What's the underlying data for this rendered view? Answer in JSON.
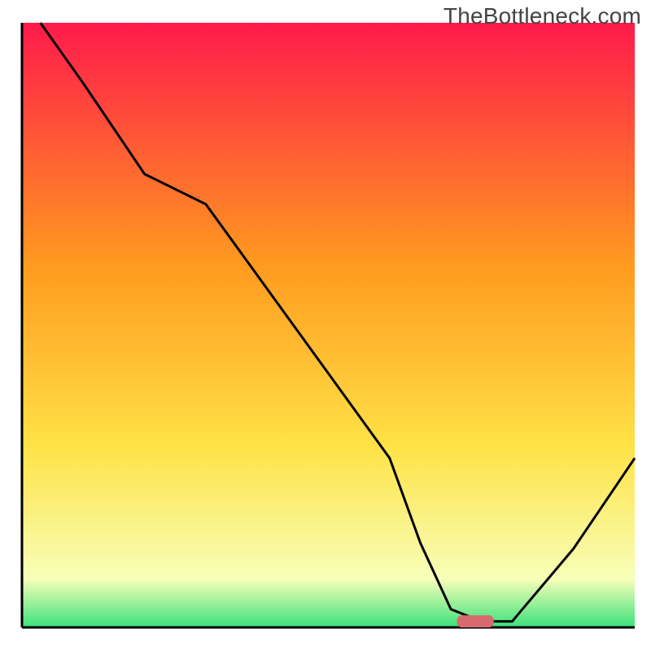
{
  "watermark": "TheBottleneck.com",
  "chart_data": {
    "type": "line",
    "title": "",
    "xlabel": "",
    "ylabel": "",
    "xlim": [
      0,
      100
    ],
    "ylim": [
      0,
      100
    ],
    "grid": false,
    "legend": false,
    "background_gradient": [
      "#ff1a4b",
      "#ff9a1f",
      "#ffe246",
      "#f7ffb8",
      "#3be27c"
    ],
    "series": [
      {
        "name": "bottleneck-curve",
        "x": [
          3,
          10,
          20,
          30,
          40,
          50,
          60,
          65,
          70,
          75,
          80,
          90,
          100
        ],
        "y": [
          100,
          90,
          75,
          70,
          56,
          42,
          28,
          14,
          3,
          1,
          1,
          13,
          28
        ]
      }
    ],
    "marker": {
      "name": "optimal-marker",
      "x": 74,
      "y": 1,
      "color": "#d86a6f",
      "width_pct": 6,
      "height_pct": 2
    }
  }
}
